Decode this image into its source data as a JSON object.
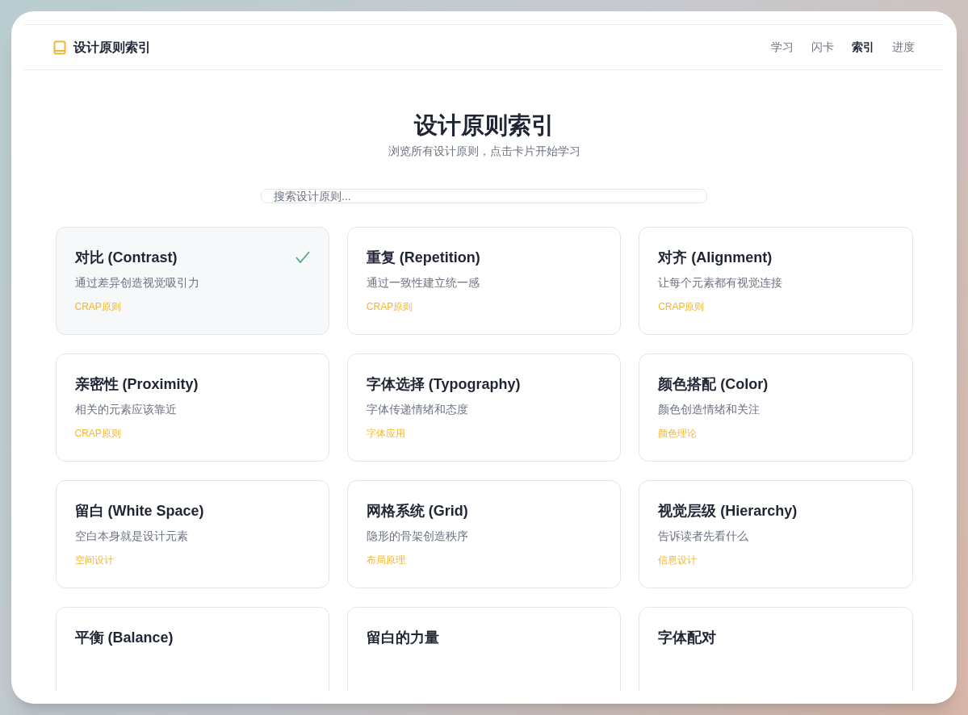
{
  "brand": {
    "title": "设计原则索引"
  },
  "nav": [
    {
      "label": "学习",
      "selected": false
    },
    {
      "label": "闪卡",
      "selected": false
    },
    {
      "label": "索引",
      "selected": true
    },
    {
      "label": "进度",
      "selected": false
    }
  ],
  "heading": "设计原则索引",
  "subtitle": "浏览所有设计原则，点击卡片开始学习",
  "search": {
    "placeholder": "搜索设计原则..."
  },
  "cards": [
    {
      "title": "对比 (Contrast)",
      "description": "通过差异创造视觉吸引力",
      "category": "CRAP原则",
      "completed": true
    },
    {
      "title": "重复 (Repetition)",
      "description": "通过一致性建立统一感",
      "category": "CRAP原则",
      "completed": false
    },
    {
      "title": "对齐 (Alignment)",
      "description": "让每个元素都有视觉连接",
      "category": "CRAP原则",
      "completed": false
    },
    {
      "title": "亲密性 (Proximity)",
      "description": "相关的元素应该靠近",
      "category": "CRAP原则",
      "completed": false
    },
    {
      "title": "字体选择 (Typography)",
      "description": "字体传递情绪和态度",
      "category": "字体应用",
      "completed": false
    },
    {
      "title": "颜色搭配 (Color)",
      "description": "颜色创造情绪和关注",
      "category": "颜色理论",
      "completed": false
    },
    {
      "title": "留白 (White Space)",
      "description": "空白本身就是设计元素",
      "category": "空间设计",
      "completed": false
    },
    {
      "title": "网格系统 (Grid)",
      "description": "隐形的骨架创造秩序",
      "category": "布局原理",
      "completed": false
    },
    {
      "title": "视觉层级 (Hierarchy)",
      "description": "告诉读者先看什么",
      "category": "信息设计",
      "completed": false
    },
    {
      "title": "平衡 (Balance)",
      "completed": false
    },
    {
      "title": "留白的力量",
      "completed": false
    },
    {
      "title": "字体配对",
      "completed": false
    }
  ]
}
